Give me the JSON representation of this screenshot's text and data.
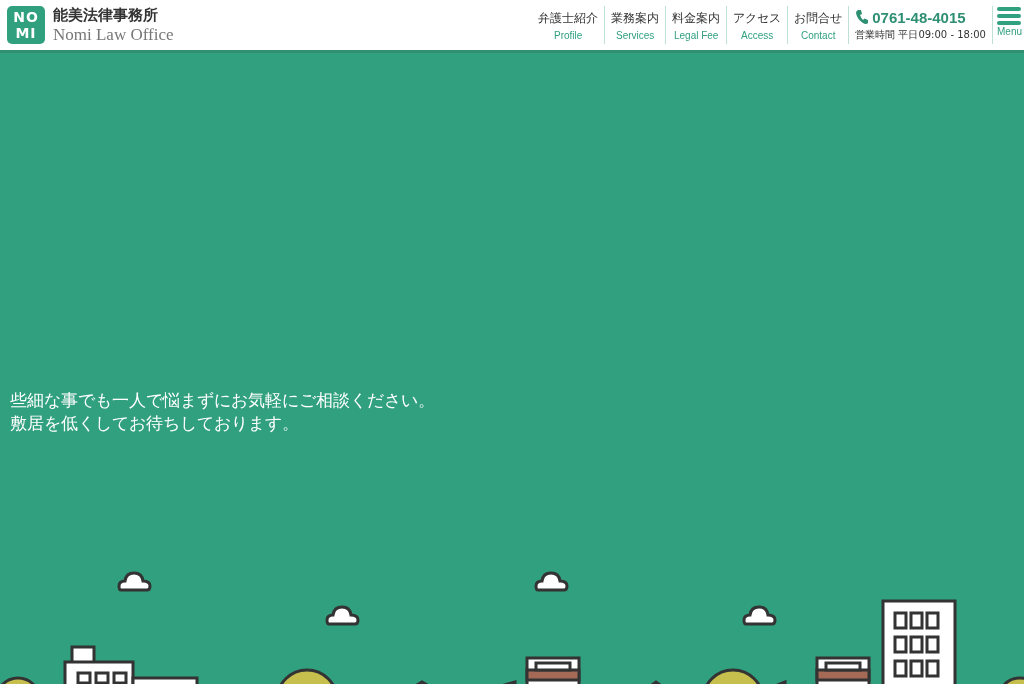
{
  "header": {
    "logo_mark": [
      "NO",
      "MI"
    ],
    "title": "能美法律事務所",
    "subtitle": "Nomi Law Office",
    "nav": [
      {
        "label": "弁護士紹介",
        "sublabel": "Profile"
      },
      {
        "label": "業務案内",
        "sublabel": "Services"
      },
      {
        "label": "料金案内",
        "sublabel": "Legal Fee"
      },
      {
        "label": "アクセス",
        "sublabel": "Access"
      },
      {
        "label": "お問合せ",
        "sublabel": "Contact"
      }
    ],
    "phone": "0761-48-4015",
    "hours": "営業時間 平日09:00 - 18:00",
    "menu_label": "Menu"
  },
  "hero": {
    "lines": [
      "些細な事でも一人で悩まずにお気軽にご相談ください。",
      "敷居を低くしてお待ちしております。"
    ]
  }
}
